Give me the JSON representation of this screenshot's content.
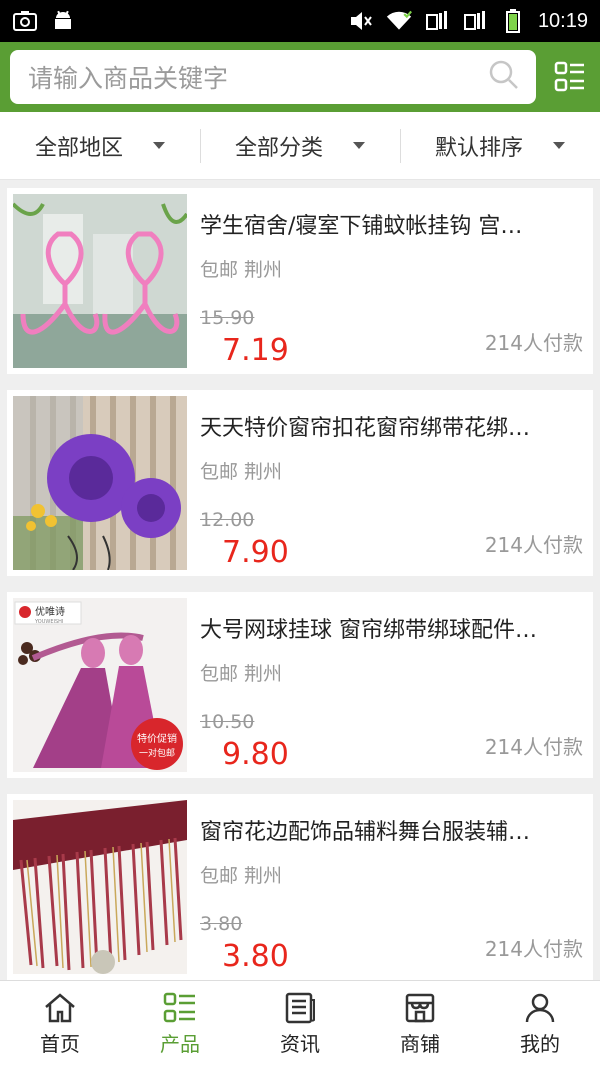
{
  "statusbar": {
    "time": "10:19"
  },
  "search": {
    "placeholder": "请输入商品关键字"
  },
  "filters": [
    "全部地区",
    "全部分类",
    "默认排序"
  ],
  "products": [
    {
      "title": "学生宿舍/寝室下铺蚊帐挂钩 宫…",
      "meta": "包邮 荆州",
      "old_price": "15.90",
      "price": "7.19",
      "paid": "214人付款",
      "thumb": "pink-hooks"
    },
    {
      "title": "天天特价窗帘扣花窗帘绑带花绑…",
      "meta": "包邮 荆州",
      "old_price": "12.00",
      "price": "7.90",
      "paid": "214人付款",
      "thumb": "purple-flowers"
    },
    {
      "title": "大号网球挂球 窗帘绑带绑球配件…",
      "meta": "包邮 荆州",
      "old_price": "10.50",
      "price": "9.80",
      "paid": "214人付款",
      "thumb": "tassels",
      "thumb_logo": "优唯诗",
      "thumb_logo_sub": "YOUWEISHI",
      "thumb_badge_1": "特价促销",
      "thumb_badge_2": "一对包邮"
    },
    {
      "title": "窗帘花边配饰品辅料舞台服装辅…",
      "meta": "包邮 荆州",
      "old_price": "3.80",
      "price": "3.80",
      "paid": "214人付款",
      "thumb": "fringe"
    }
  ],
  "tabs": [
    {
      "label": "首页",
      "icon": "home-icon"
    },
    {
      "label": "产品",
      "icon": "product-grid-icon"
    },
    {
      "label": "资讯",
      "icon": "news-icon"
    },
    {
      "label": "商铺",
      "icon": "shop-icon"
    },
    {
      "label": "我的",
      "icon": "user-icon"
    }
  ],
  "colors": {
    "brand_green": "#5a9e34",
    "price_red": "#e8261c"
  }
}
